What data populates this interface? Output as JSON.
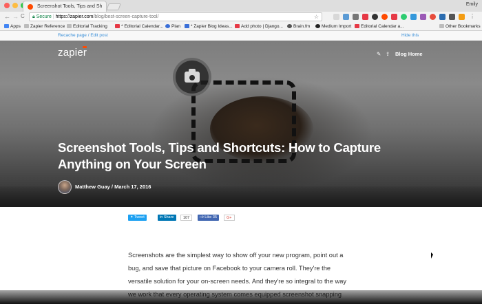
{
  "browser": {
    "tab_title": "Screenshot Tools, Tips and Sh",
    "tab_close": "×",
    "user_name": "Emily",
    "url_secure_label": "Secure",
    "url_host": "https://zapier.com",
    "url_path": "/blog/best-screen-capture-tool/",
    "nav_back": "←",
    "nav_forward": "→",
    "nav_reload": "C",
    "bookmark_star": "☆",
    "bookmarks": [
      {
        "label": "Apps"
      },
      {
        "label": "Zapier Reference"
      },
      {
        "label": "Editorial Tracking"
      },
      {
        "label": "* Editorial Calendar..."
      },
      {
        "label": "Plan"
      },
      {
        "label": "* Zapier Blog Ideas..."
      },
      {
        "label": "Add photo | Django..."
      },
      {
        "label": "Brain.fm"
      },
      {
        "label": "Medium Import"
      },
      {
        "label": "Editorial Calendar a..."
      },
      {
        "label": "Other Bookmarks"
      }
    ],
    "colors": {
      "accent": "#ff4a00",
      "secure": "#0b8043"
    }
  },
  "page": {
    "recache_link": "Recache page / Edit post",
    "hide_link": "Hide this",
    "logo_text": "zapier",
    "edit_icon": "✎",
    "share_icon": "⇪",
    "blog_home": "Blog Home",
    "title": "Screenshot Tools, Tips and Shortcuts: How to Capture Anything on Your Screen",
    "byline": "Matthew Guay / March 17, 2016",
    "share": {
      "tweet": "Tweet",
      "linkedin": "Share",
      "linkedin_count": "107",
      "facebook": "Like 35",
      "gplus": "G+"
    },
    "body_text": "Screenshots are the simplest way to show off your new program, point out a bug, and save that picture on Facebook to your camera roll. They're the versatile solution for your on-screen needs. And they're so integral to the way we work that every operating system comes equipped screenshot snapping"
  }
}
